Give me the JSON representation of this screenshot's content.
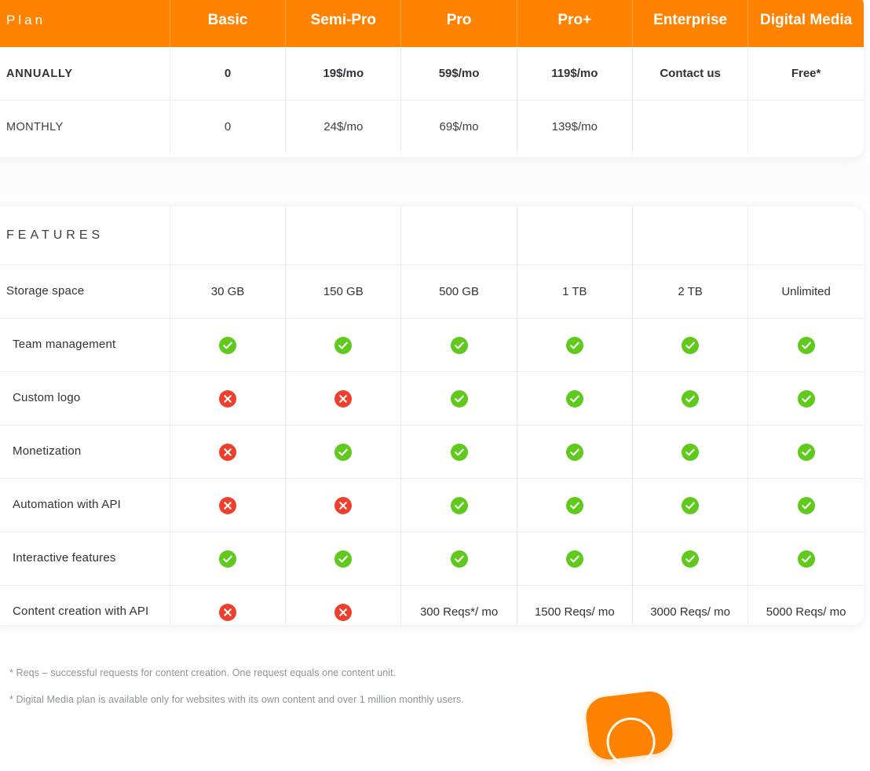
{
  "theme": {
    "accent_orange": "#FF8200",
    "check_green": "#5FC91C",
    "cross_red": "#EF3F2C",
    "text_dark": "#2F3337",
    "text_muted": "#8D9398",
    "border": "#ECECEC"
  },
  "pricing": {
    "label_header": "Plan",
    "plans": [
      "Basic",
      "Semi-Pro",
      "Pro",
      "Pro+",
      "Enterprise",
      "Digital Media"
    ],
    "rows": [
      {
        "label": "ANNUALLY",
        "emphasis": "bold",
        "values": [
          "0",
          "19$/mo",
          "59$/mo",
          "119$/mo",
          "Contact us",
          "Free*"
        ]
      },
      {
        "label": "MONTHLY",
        "emphasis": "normal",
        "values": [
          "0",
          "24$/mo",
          "69$/mo",
          "139$/mo",
          "",
          ""
        ]
      }
    ]
  },
  "features": {
    "section_title": "FEATURES",
    "rows": [
      {
        "label": "Storage space",
        "type": "text",
        "values": [
          "30 GB",
          "150 GB",
          "500 GB",
          "1 TB",
          "2 TB",
          "Unlimited"
        ]
      },
      {
        "label": "Team management",
        "type": "status",
        "values": [
          "yes",
          "yes",
          "yes",
          "yes",
          "yes",
          "yes"
        ]
      },
      {
        "label": "Custom logo",
        "type": "status",
        "values": [
          "no",
          "no",
          "yes",
          "yes",
          "yes",
          "yes"
        ]
      },
      {
        "label": "Monetization",
        "type": "status",
        "values": [
          "no",
          "yes",
          "yes",
          "yes",
          "yes",
          "yes"
        ]
      },
      {
        "label": "Automation with API",
        "type": "status",
        "values": [
          "no",
          "no",
          "yes",
          "yes",
          "yes",
          "yes"
        ]
      },
      {
        "label": "Interactive features",
        "type": "status",
        "values": [
          "yes",
          "yes",
          "yes",
          "yes",
          "yes",
          "yes"
        ]
      },
      {
        "label": "Content creation with API",
        "type": "mixed",
        "values": [
          "no",
          "no",
          "300 Reqs*/ mo",
          "1500 Reqs/ mo",
          "3000 Reqs/ mo",
          "5000 Reqs/ mo"
        ]
      }
    ]
  },
  "footnotes": [
    "* Reqs – successful requests for content creation. One request equals one content unit.",
    "* Digital Media plan is available only for websites with its own content and over 1 million monthly users."
  ],
  "chat_widget": {
    "icon": "chat-support-icon"
  }
}
